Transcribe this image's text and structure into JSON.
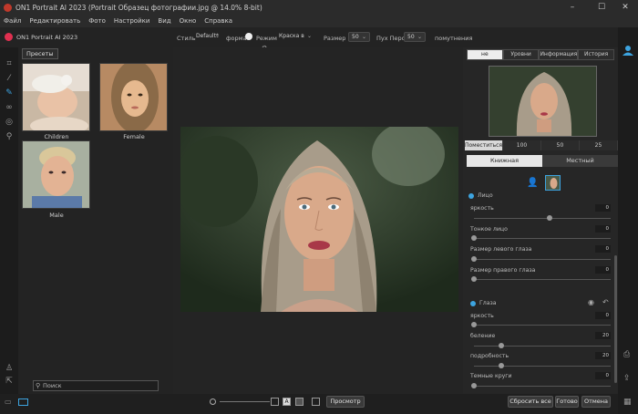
{
  "window": {
    "title": "ON1 Portrait AI 2023 (Portrait Образец фотографии.jpg @ 14.0% 8-bit)",
    "minimize": "–",
    "maximize": "☐",
    "close": "✕"
  },
  "menu": [
    "Файл",
    "Редактировать",
    "Фото",
    "Настройки",
    "Вид",
    "Окно",
    "Справка"
  ],
  "brand": "ON1 Portrait AI 2023",
  "options": {
    "style_label": "Стиль",
    "style_value": "Default*",
    "form_label": "форма",
    "mode_label": "Режим",
    "mode_value": "Краска в",
    "size_label": "Размер",
    "size_value": "50",
    "feather_label": "Пух Перо",
    "feather_value": "50",
    "opacity_label": "помутнения"
  },
  "presets": {
    "tab": "Пресеты",
    "items": [
      {
        "label": "Children"
      },
      {
        "label": "Female"
      },
      {
        "label": "Male"
      }
    ],
    "search_placeholder": "Поиск"
  },
  "right": {
    "tabs": [
      {
        "label": "не",
        "selected": true
      },
      {
        "label": "Уровни",
        "selected": false
      },
      {
        "label": "Информация",
        "selected": false
      },
      {
        "label": "История",
        "selected": false
      }
    ],
    "zoom": [
      {
        "label": "Поместиться",
        "selected": true
      },
      {
        "label": "100",
        "selected": false
      },
      {
        "label": "50",
        "selected": false
      },
      {
        "label": "25",
        "selected": false
      }
    ],
    "modes": [
      {
        "label": "Книжная",
        "selected": true
      },
      {
        "label": "Местный",
        "selected": false
      }
    ],
    "face_section": "Лицо",
    "face_params": [
      {
        "label": "яркость",
        "value": "0",
        "level": 0.55
      },
      {
        "label": "Тонкое лицо",
        "value": "0",
        "level": 0.0
      },
      {
        "label": "Размер левого глаза",
        "value": "0",
        "level": 0.0
      },
      {
        "label": "Размер правого глаза",
        "value": "0",
        "level": 0.0
      }
    ],
    "eyes_section": "Глаза",
    "eyes_params": [
      {
        "label": "яркость",
        "value": "0",
        "level": 0.0
      },
      {
        "label": "беление",
        "value": "20",
        "level": 0.2
      },
      {
        "label": "подробность",
        "value": "20",
        "level": 0.2
      },
      {
        "label": "Темные круги",
        "value": "0",
        "level": 0.0
      }
    ]
  },
  "bottom": {
    "preview": "Просмотр",
    "reset_all": "Сбросить все",
    "done": "Готово",
    "cancel": "Отмена",
    "text_tool": "A"
  },
  "colors": {
    "accent": "#3da4e0",
    "brand": "#e03050"
  }
}
